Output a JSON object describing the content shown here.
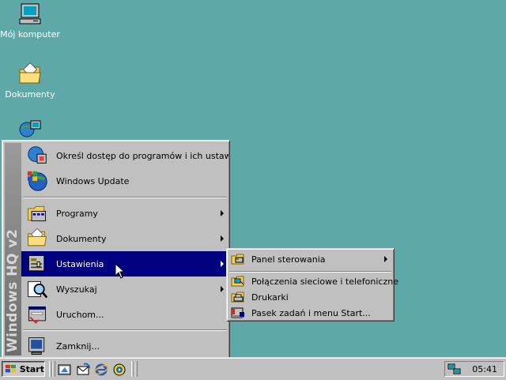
{
  "desktop": {
    "icons": [
      {
        "label": "Mój komputer",
        "icon": "my-computer-icon"
      },
      {
        "label": "Dokumenty",
        "icon": "folder-icon"
      },
      {
        "label": "",
        "icon": "network-icon"
      }
    ]
  },
  "start_menu": {
    "banner": "Windows HQ v2",
    "items": [
      {
        "label": "Określ dostęp do programów i ich ustawie...",
        "icon": "program-access-icon"
      },
      {
        "label": "Windows Update",
        "icon": "windows-update-icon"
      },
      {
        "label": "Programy",
        "icon": "programs-icon",
        "submenu": true
      },
      {
        "label": "Dokumenty",
        "icon": "documents-folder-icon",
        "submenu": true
      },
      {
        "label": "Ustawienia",
        "icon": "settings-icon",
        "submenu": true,
        "selected": true
      },
      {
        "label": "Wyszukaj",
        "icon": "search-icon",
        "submenu": true
      },
      {
        "label": "Uruchom...",
        "icon": "run-icon"
      },
      {
        "label": "Zamknij...",
        "icon": "shutdown-icon"
      }
    ]
  },
  "settings_submenu": {
    "items": [
      {
        "label": "Panel sterowania",
        "icon": "control-panel-icon",
        "submenu": true
      },
      {
        "label": "Połączenia sieciowe i telefoniczne",
        "icon": "network-connections-icon"
      },
      {
        "label": "Drukarki",
        "icon": "printers-icon"
      },
      {
        "label": "Pasek zadań i menu Start...",
        "icon": "taskbar-settings-icon"
      }
    ]
  },
  "taskbar": {
    "start_label": "Start",
    "quick_launch": [
      "show-desktop-icon",
      "outlook-express-icon",
      "internet-explorer-icon",
      "media-player-icon"
    ],
    "clock": "05:41"
  },
  "colors": {
    "desktop": "#5fa8a8",
    "highlight": "#000080",
    "face": "#c0c0c0"
  }
}
